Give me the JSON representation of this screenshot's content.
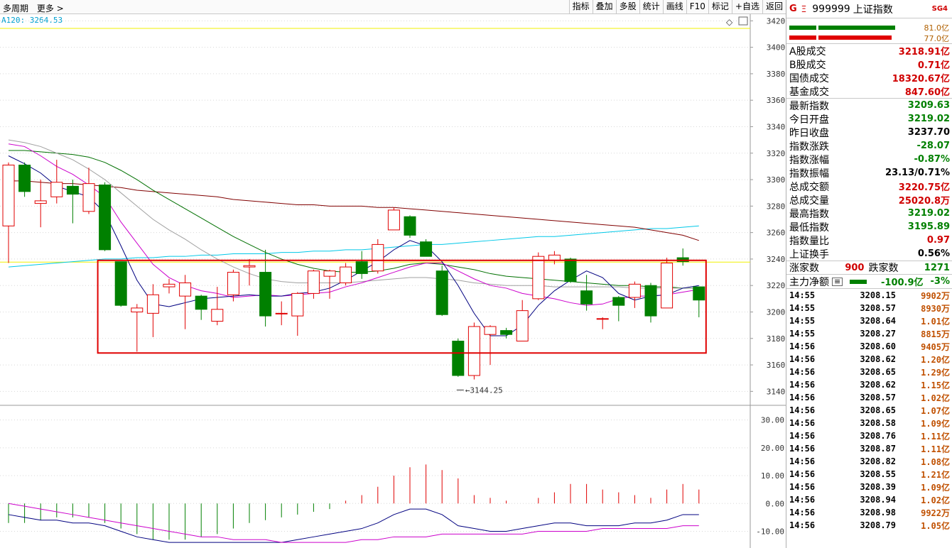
{
  "toolbar": {
    "left": [
      "多周期",
      "更多 >"
    ],
    "buttons": [
      "指标",
      "叠加",
      "多股",
      "统计",
      "画线",
      "F10",
      "标记",
      "+自选",
      "返回"
    ]
  },
  "ma_readout": "A120: 3264.53",
  "sidebar": {
    "title": {
      "g": "G",
      "menu": "Ξ",
      "code": "999999",
      "name": "上证指数",
      "sg": "SG4"
    },
    "bars": {
      "top_value": "81.0亿",
      "bottom_value": "77.0亿"
    },
    "turnover": [
      {
        "label": "A股成交",
        "value": "3218.91亿"
      },
      {
        "label": "B股成交",
        "value": "0.71亿"
      },
      {
        "label": "国债成交",
        "value": "18320.67亿"
      },
      {
        "label": "基金成交",
        "value": "847.60亿"
      }
    ],
    "stats": [
      {
        "label": "最新指数",
        "value": "3209.63",
        "color": "green"
      },
      {
        "label": "今日开盘",
        "value": "3219.02",
        "color": "green"
      },
      {
        "label": "昨日收盘",
        "value": "3237.70",
        "color": "blk"
      },
      {
        "label": "指数涨跌",
        "value": "-28.07",
        "color": "green"
      },
      {
        "label": "指数涨幅",
        "value": "-0.87%",
        "color": "green"
      },
      {
        "label": "指数振幅",
        "value": "23.13/0.71%",
        "color": "blk"
      },
      {
        "label": "总成交额",
        "value": "3220.75亿",
        "color": "red"
      },
      {
        "label": "总成交量",
        "value": "25020.8万",
        "color": "red"
      },
      {
        "label": "最高指数",
        "value": "3219.02",
        "color": "green"
      },
      {
        "label": "最低指数",
        "value": "3195.89",
        "color": "green"
      },
      {
        "label": "指数量比",
        "value": "0.97",
        "color": "red"
      },
      {
        "label": "上证换手",
        "value": "0.56%",
        "color": "blk"
      }
    ],
    "breadth": {
      "up_label": "涨家数",
      "up": "900",
      "down_label": "跌家数",
      "down": "1271"
    },
    "main_flow": {
      "label": "主力净额",
      "value": "-100.9亿",
      "pct": "-3%"
    },
    "trades": [
      {
        "t": "14:55",
        "p": "3208.15",
        "v": "9902万"
      },
      {
        "t": "14:55",
        "p": "3208.57",
        "v": "8930万"
      },
      {
        "t": "14:55",
        "p": "3208.64",
        "v": "1.01亿"
      },
      {
        "t": "14:55",
        "p": "3208.27",
        "v": "8815万"
      },
      {
        "t": "14:56",
        "p": "3208.60",
        "v": "9405万"
      },
      {
        "t": "14:56",
        "p": "3208.62",
        "v": "1.20亿"
      },
      {
        "t": "14:56",
        "p": "3208.65",
        "v": "1.29亿"
      },
      {
        "t": "14:56",
        "p": "3208.62",
        "v": "1.15亿"
      },
      {
        "t": "14:56",
        "p": "3208.57",
        "v": "1.02亿"
      },
      {
        "t": "14:56",
        "p": "3208.65",
        "v": "1.07亿"
      },
      {
        "t": "14:56",
        "p": "3208.58",
        "v": "1.09亿"
      },
      {
        "t": "14:56",
        "p": "3208.76",
        "v": "1.11亿"
      },
      {
        "t": "14:56",
        "p": "3208.87",
        "v": "1.11亿"
      },
      {
        "t": "14:56",
        "p": "3208.82",
        "v": "1.08亿"
      },
      {
        "t": "14:56",
        "p": "3208.55",
        "v": "1.21亿"
      },
      {
        "t": "14:56",
        "p": "3208.39",
        "v": "1.09亿"
      },
      {
        "t": "14:56",
        "p": "3208.94",
        "v": "1.02亿"
      },
      {
        "t": "14:56",
        "p": "3208.98",
        "v": "9922万"
      },
      {
        "t": "14:56",
        "p": "3208.79",
        "v": "1.05亿"
      }
    ]
  },
  "chart_data": {
    "type": "candlestick",
    "price_axis": {
      "ylim": [
        3130,
        3425
      ],
      "ticks": [
        3140,
        3160,
        3180,
        3200,
        3220,
        3240,
        3260,
        3280,
        3300,
        3320,
        3340,
        3360,
        3380,
        3400,
        3420
      ]
    },
    "macd_axis": {
      "ylim": [
        -16,
        35
      ],
      "ticks": [
        "30.00",
        "20.00",
        "10.00",
        "0.00",
        "-10.00"
      ]
    },
    "low_annotation": "3144.25",
    "colors": {
      "up": "#e00000",
      "down": "#008000",
      "ma5": "#000080",
      "ma10": "#cc00cc",
      "ma20": "#a0a0a0",
      "ma30": "#007000",
      "ma60": "#800000",
      "ma120": "#00c8e8",
      "prev_close": "#f0f000",
      "box": "#e00000",
      "dif": "#000080",
      "dea": "#cc00cc"
    },
    "candles": [
      {
        "o": 3265,
        "h": 3313,
        "l": 3237,
        "c": 3311
      },
      {
        "o": 3311,
        "h": 3313,
        "l": 3287,
        "c": 3291
      },
      {
        "o": 3282,
        "h": 3300,
        "l": 3264,
        "c": 3284
      },
      {
        "o": 3287,
        "h": 3315,
        "l": 3282,
        "c": 3298
      },
      {
        "o": 3295,
        "h": 3300,
        "l": 3267,
        "c": 3289
      },
      {
        "o": 3276,
        "h": 3309,
        "l": 3274,
        "c": 3297
      },
      {
        "o": 3296,
        "h": 3298,
        "l": 3246,
        "c": 3247
      },
      {
        "o": 3238,
        "h": 3238,
        "l": 3204,
        "c": 3205
      },
      {
        "o": 3200,
        "h": 3206,
        "l": 3170,
        "c": 3203
      },
      {
        "o": 3199,
        "h": 3221,
        "l": 3181,
        "c": 3213
      },
      {
        "o": 3219,
        "h": 3225,
        "l": 3214,
        "c": 3221
      },
      {
        "o": 3212,
        "h": 3228,
        "l": 3187,
        "c": 3222
      },
      {
        "o": 3212,
        "h": 3213,
        "l": 3194,
        "c": 3202
      },
      {
        "o": 3193,
        "h": 3219,
        "l": 3190,
        "c": 3202
      },
      {
        "o": 3213,
        "h": 3232,
        "l": 3208,
        "c": 3230
      },
      {
        "o": 3234,
        "h": 3240,
        "l": 3220,
        "c": 3235
      },
      {
        "o": 3230,
        "h": 3247,
        "l": 3189,
        "c": 3197
      },
      {
        "o": 3199,
        "h": 3208,
        "l": 3190,
        "c": 3199
      },
      {
        "o": 3197,
        "h": 3215,
        "l": 3182,
        "c": 3214
      },
      {
        "o": 3214,
        "h": 3232,
        "l": 3210,
        "c": 3231
      },
      {
        "o": 3227,
        "h": 3232,
        "l": 3210,
        "c": 3231
      },
      {
        "o": 3222,
        "h": 3237,
        "l": 3220,
        "c": 3234
      },
      {
        "o": 3238,
        "h": 3246,
        "l": 3225,
        "c": 3229
      },
      {
        "o": 3231,
        "h": 3255,
        "l": 3229,
        "c": 3251
      },
      {
        "o": 3262,
        "h": 3279,
        "l": 3262,
        "c": 3277
      },
      {
        "o": 3272,
        "h": 3273,
        "l": 3256,
        "c": 3258
      },
      {
        "o": 3253,
        "h": 3255,
        "l": 3242,
        "c": 3242
      },
      {
        "o": 3231,
        "h": 3235,
        "l": 3197,
        "c": 3198
      },
      {
        "o": 3178,
        "h": 3180,
        "l": 3151,
        "c": 3152
      },
      {
        "o": 3152,
        "h": 3192,
        "l": 3149,
        "c": 3189
      },
      {
        "o": 3183,
        "h": 3190,
        "l": 3160,
        "c": 3189
      },
      {
        "o": 3186,
        "h": 3188,
        "l": 3180,
        "c": 3183
      },
      {
        "o": 3178,
        "h": 3209,
        "l": 3178,
        "c": 3201
      },
      {
        "o": 3210,
        "h": 3245,
        "l": 3209,
        "c": 3242
      },
      {
        "o": 3239,
        "h": 3246,
        "l": 3236,
        "c": 3243
      },
      {
        "o": 3240,
        "h": 3241,
        "l": 3222,
        "c": 3223
      },
      {
        "o": 3216,
        "h": 3228,
        "l": 3201,
        "c": 3206
      },
      {
        "o": 3195,
        "h": 3196,
        "l": 3187,
        "c": 3195
      },
      {
        "o": 3211,
        "h": 3212,
        "l": 3193,
        "c": 3205
      },
      {
        "o": 3211,
        "h": 3223,
        "l": 3203,
        "c": 3221
      },
      {
        "o": 3220,
        "h": 3222,
        "l": 3192,
        "c": 3197
      },
      {
        "o": 3203,
        "h": 3241,
        "l": 3203,
        "c": 3237
      },
      {
        "o": 3241,
        "h": 3248,
        "l": 3235,
        "c": 3238
      },
      {
        "o": 3219,
        "h": 3219,
        "l": 3196,
        "c": 3209
      }
    ],
    "ma5": [
      3318,
      3312,
      3305,
      3295,
      3291,
      3287,
      3275,
      3250,
      3224,
      3206,
      3204,
      3207,
      3210,
      3211,
      3212,
      3213,
      3212,
      3212,
      3214,
      3215,
      3218,
      3224,
      3231,
      3238,
      3247,
      3254,
      3250,
      3238,
      3220,
      3199,
      3182,
      3182,
      3190,
      3205,
      3216,
      3224,
      3231,
      3226,
      3214,
      3209,
      3212,
      3213,
      3218,
      3220
    ],
    "ma10": [
      3327,
      3325,
      3318,
      3310,
      3304,
      3296,
      3287,
      3268,
      3252,
      3236,
      3226,
      3220,
      3216,
      3214,
      3211,
      3212,
      3213,
      3212,
      3213,
      3214,
      3215,
      3219,
      3222,
      3226,
      3230,
      3234,
      3237,
      3237,
      3231,
      3225,
      3220,
      3218,
      3214,
      3212,
      3210,
      3207,
      3205,
      3206,
      3210,
      3212,
      3212,
      3213,
      3215,
      3217
    ],
    "ma20": [
      3330,
      3328,
      3325,
      3320,
      3315,
      3308,
      3300,
      3290,
      3280,
      3270,
      3262,
      3255,
      3247,
      3240,
      3234,
      3229,
      3225,
      3223,
      3222,
      3222,
      3222,
      3222,
      3223,
      3224,
      3225,
      3226,
      3226,
      3225,
      3224,
      3222,
      3221,
      3220,
      3220,
      3220,
      3219,
      3219,
      3219,
      3219,
      3219,
      3218,
      3218,
      3218,
      3218,
      3218
    ],
    "ma30": [
      3322,
      3322,
      3321,
      3320,
      3319,
      3317,
      3313,
      3307,
      3300,
      3292,
      3285,
      3278,
      3271,
      3264,
      3257,
      3251,
      3245,
      3240,
      3236,
      3233,
      3231,
      3230,
      3230,
      3231,
      3233,
      3236,
      3237,
      3236,
      3234,
      3232,
      3229,
      3227,
      3226,
      3225,
      3224,
      3223,
      3222,
      3221,
      3220,
      3220,
      3219,
      3219,
      3218,
      3218
    ],
    "ma60": [
      3299,
      3299,
      3298,
      3297,
      3297,
      3296,
      3295,
      3294,
      3292,
      3291,
      3290,
      3289,
      3288,
      3287,
      3285,
      3284,
      3283,
      3282,
      3281,
      3281,
      3280,
      3280,
      3280,
      3279,
      3279,
      3278,
      3277,
      3276,
      3275,
      3274,
      3273,
      3272,
      3271,
      3270,
      3269,
      3268,
      3267,
      3266,
      3265,
      3264,
      3262,
      3260,
      3258,
      3254
    ],
    "ma120": [
      3234,
      3235,
      3236,
      3237,
      3238,
      3239,
      3240,
      3240,
      3241,
      3241,
      3242,
      3242,
      3243,
      3243,
      3244,
      3244,
      3244,
      3245,
      3245,
      3246,
      3246,
      3247,
      3247,
      3248,
      3249,
      3250,
      3251,
      3251,
      3252,
      3253,
      3254,
      3255,
      3256,
      3257,
      3257,
      3258,
      3259,
      3260,
      3261,
      3262,
      3263,
      3263,
      3264,
      3265
    ],
    "prev_close": 3237.7,
    "box": {
      "start_index": 6,
      "end_index": 43,
      "top": 3239,
      "bottom": 3169
    },
    "macd_hist": [
      -7,
      -7,
      -6,
      -5,
      -5,
      -5,
      -7,
      -9,
      -11,
      -13,
      -13,
      -13,
      -12,
      -11,
      -9,
      -7,
      -6,
      -5,
      -4,
      -3,
      -2,
      1,
      3,
      6,
      10,
      13,
      14,
      12,
      9,
      3,
      2,
      1,
      0,
      2,
      4,
      7,
      7,
      5,
      4,
      3,
      2,
      5,
      7,
      5
    ],
    "macd_dif": [
      -4,
      -5,
      -6,
      -6,
      -7,
      -7,
      -8,
      -10,
      -12,
      -13,
      -14,
      -14,
      -14,
      -14,
      -14,
      -14,
      -14,
      -14,
      -13,
      -12,
      -11,
      -10,
      -9,
      -7,
      -4,
      -2,
      -2,
      -4,
      -8,
      -9,
      -10,
      -10,
      -9,
      -8,
      -7,
      -7,
      -8,
      -8,
      -8,
      -7,
      -7,
      -6,
      -4,
      -4
    ],
    "macd_dea": [
      0,
      -1,
      -2,
      -3,
      -4,
      -5,
      -6,
      -7,
      -8,
      -9,
      -10,
      -11,
      -12,
      -12,
      -13,
      -13,
      -13,
      -14,
      -14,
      -14,
      -14,
      -14,
      -13,
      -13,
      -12,
      -12,
      -12,
      -11,
      -11,
      -11,
      -11,
      -11,
      -11,
      -10,
      -10,
      -10,
      -10,
      -9,
      -9,
      -9,
      -9,
      -9,
      -8,
      -8
    ]
  }
}
